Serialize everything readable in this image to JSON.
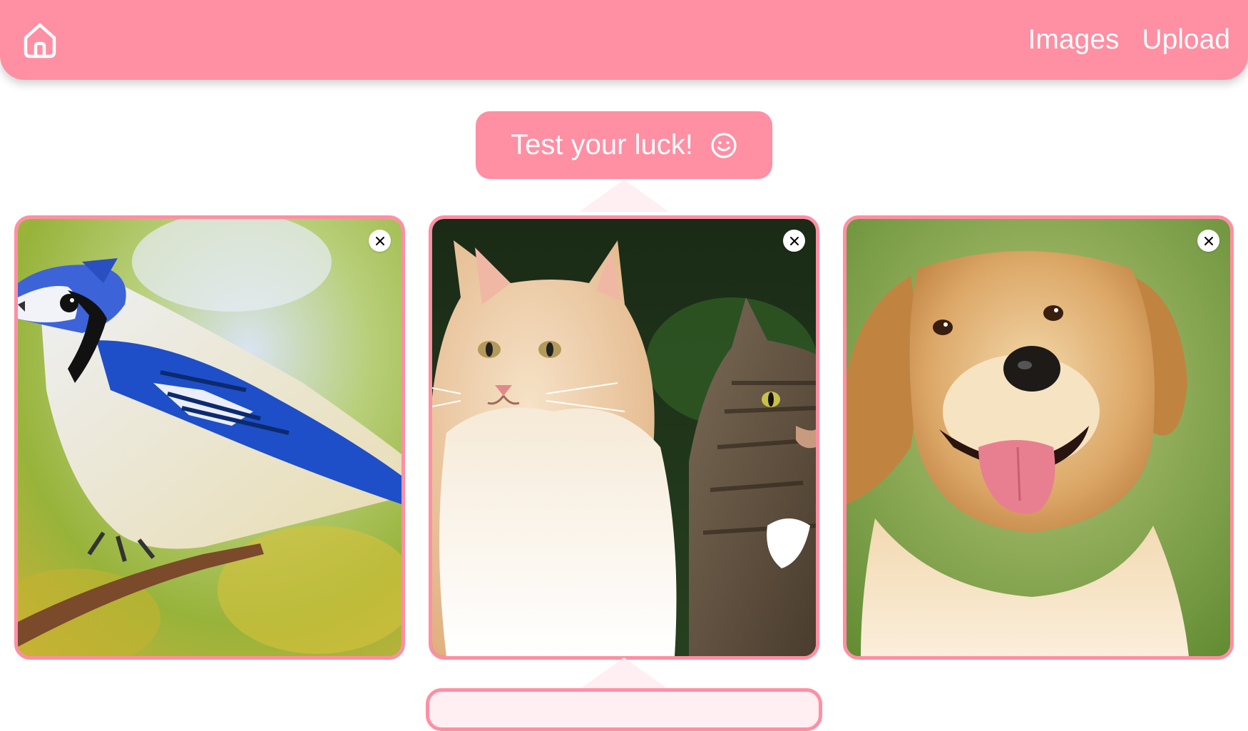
{
  "navbar": {
    "home_icon": "home-icon",
    "links": [
      "Images",
      "Upload"
    ]
  },
  "luck_button": {
    "label": "Test your luck!",
    "icon": "smiley-face-icon"
  },
  "cards": [
    {
      "subject": "Blue jay bird perched on a branch",
      "close_icon": "close-icon"
    },
    {
      "subject": "Fluffy cream cat next to a tabby cat",
      "close_icon": "close-icon"
    },
    {
      "subject": "Golden retriever dog with tongue out",
      "close_icon": "close-icon"
    }
  ],
  "colors": {
    "accent": "#ff8fa3",
    "accent_light": "#ffeef2",
    "text_on_accent": "#ffffff"
  }
}
